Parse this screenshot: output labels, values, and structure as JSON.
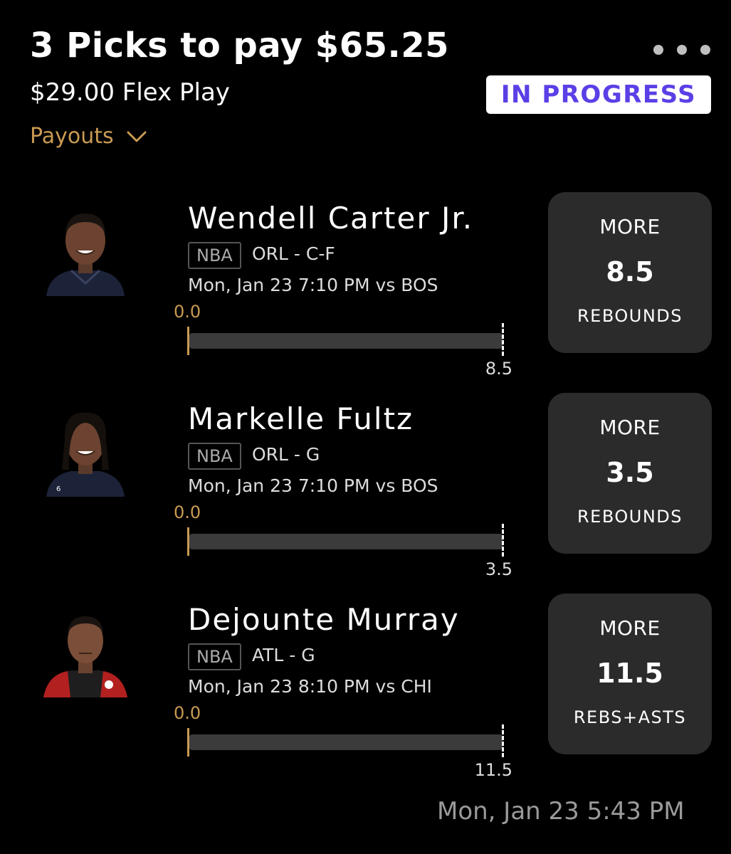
{
  "header": {
    "title": "3 Picks to pay $65.25",
    "subtitle": "$29.00 Flex Play",
    "payouts_label": "Payouts",
    "status": "IN PROGRESS"
  },
  "colors": {
    "accent_gold": "#c99a52",
    "status_purple": "#5b3fe6",
    "card_bg": "#2b2b2b"
  },
  "picks": [
    {
      "player": "Wendell Carter Jr.",
      "league": "NBA",
      "team_pos": "ORL - C-F",
      "game": "Mon, Jan 23 7:10 PM  vs BOS",
      "current": "0.0",
      "target": "8.5",
      "progress": 0.0,
      "direction": "MORE",
      "line": "8.5",
      "stat": "REBOUNDS",
      "jersey": "dark"
    },
    {
      "player": "Markelle Fultz",
      "league": "NBA",
      "team_pos": "ORL - G",
      "game": "Mon, Jan 23 7:10 PM  vs BOS",
      "current": "0.0",
      "target": "3.5",
      "progress": 0.0,
      "direction": "MORE",
      "line": "3.5",
      "stat": "REBOUNDS",
      "jersey": "dark"
    },
    {
      "player": "Dejounte Murray",
      "league": "NBA",
      "team_pos": "ATL - G",
      "game": "Mon, Jan 23 8:10 PM  vs CHI",
      "current": "0.0",
      "target": "11.5",
      "progress": 0.0,
      "direction": "MORE",
      "line": "11.5",
      "stat": "REBS+ASTS",
      "jersey": "red"
    }
  ],
  "footer": {
    "timestamp": "Mon, Jan 23 5:43 PM"
  }
}
